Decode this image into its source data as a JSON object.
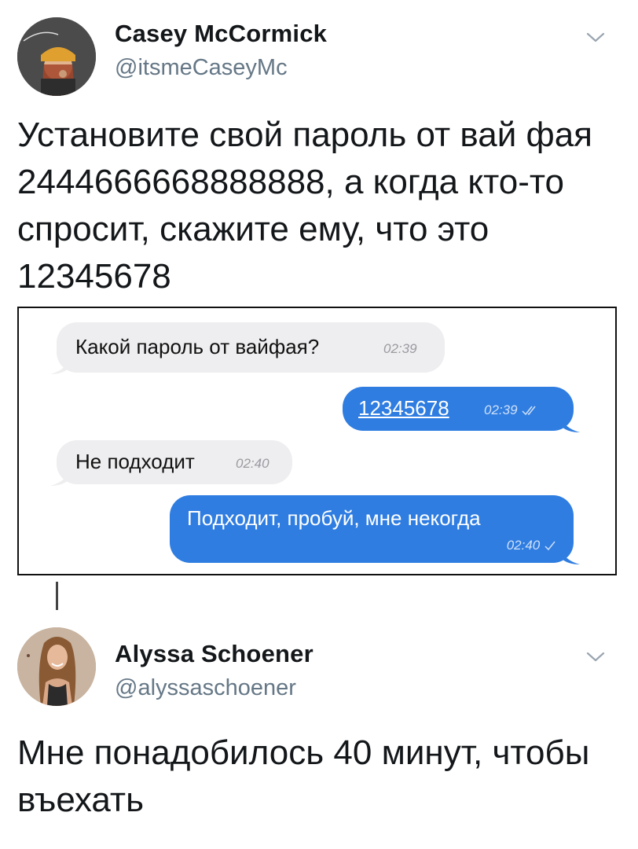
{
  "tweet1": {
    "author_name": "Casey McCormick",
    "author_handle": "@itsmeCaseyMc",
    "avatar_icon": "profile-photo",
    "text": "Установите свой пароль от вай фая 2444666668888888, а когда кто-то спросит, скажите ему, что это 12345678"
  },
  "chat": {
    "messages": [
      {
        "text": "Какой пароль от вайфая?",
        "time": "02:39",
        "direction": "incoming"
      },
      {
        "text": "12345678",
        "time": "02:39",
        "direction": "outgoing",
        "status_icon": "double-check-icon"
      },
      {
        "text": "Не подходит",
        "time": "02:40",
        "direction": "incoming"
      },
      {
        "text": "Подходит, пробуй, мне некогда",
        "time": "02:40",
        "direction": "outgoing",
        "status_icon": "check-icon"
      }
    ],
    "colors": {
      "incoming_bg": "#eeeef0",
      "outgoing_bg": "#2f7de1"
    }
  },
  "tweet2": {
    "author_name": "Alyssa Schoener",
    "author_handle": "@alyssaschoener",
    "avatar_icon": "profile-photo",
    "text": "Мне понадобилось 40 минут, чтобы въехать"
  }
}
